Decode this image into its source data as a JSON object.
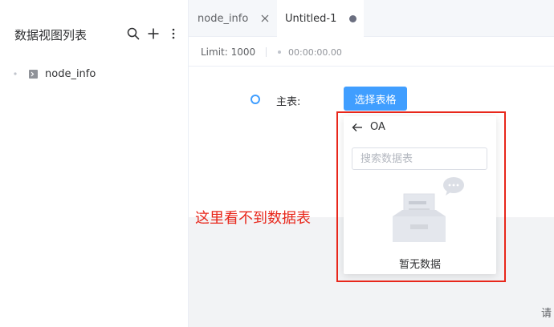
{
  "sidebar": {
    "title": "数据视图列表",
    "icons": [
      "search-icon",
      "plus-icon",
      "more-vertical-icon"
    ],
    "tree": [
      {
        "label": "node_info",
        "icon": "terminal-icon"
      }
    ]
  },
  "tabs": [
    {
      "label": "node_info",
      "action": "close-icon"
    },
    {
      "label": "Untitled-1",
      "action": "unsaved-dot-icon",
      "active": true
    }
  ],
  "toolbar": {
    "limit": "Limit: 1000",
    "timer": "00:00:00.00"
  },
  "main": {
    "main_table_label": "主表:",
    "select_table_button": "选择表格",
    "hint_partial": "请"
  },
  "popup": {
    "title": "OA",
    "search_placeholder": "搜索数据表",
    "empty_text": "暂无数据"
  },
  "annotation": {
    "text": "这里看不到数据表",
    "color": "#e8271b"
  },
  "colors": {
    "primary": "#409eff",
    "annotation": "#e8271b"
  }
}
